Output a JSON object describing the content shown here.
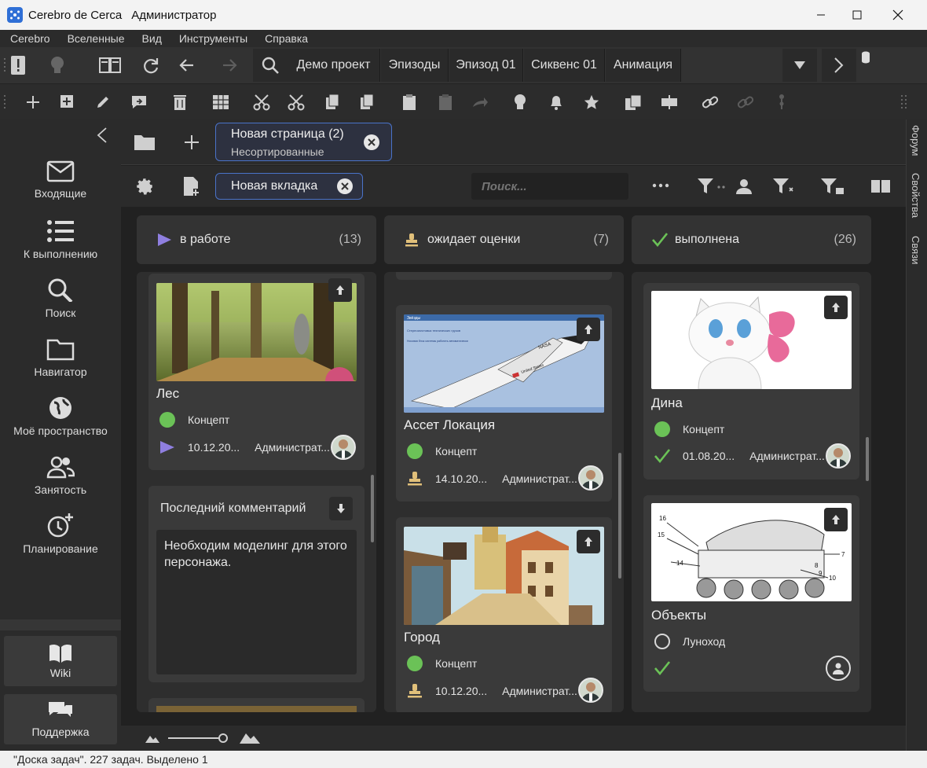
{
  "window": {
    "app_name": "Cerebro de Cerca",
    "user": "Администратор"
  },
  "menu": [
    "Cerebro",
    "Вселенные",
    "Вид",
    "Инструменты",
    "Справка"
  ],
  "breadcrumbs": [
    "Демо проект",
    "Эпизоды",
    "Эпизод 01",
    "Сиквенс 01",
    "Анимация"
  ],
  "sidebar": {
    "items": [
      {
        "label": "Входящие",
        "icon": "mail-icon"
      },
      {
        "label": "К выполнению",
        "icon": "list-icon"
      },
      {
        "label": "Поиск",
        "icon": "search-icon"
      },
      {
        "label": "Навигатор",
        "icon": "folder-icon"
      },
      {
        "label": "Моё пространство",
        "icon": "globe-icon"
      },
      {
        "label": "Занятость",
        "icon": "people-icon"
      },
      {
        "label": "Планирование",
        "icon": "clock-plus-icon"
      }
    ],
    "wiki": "Wiki",
    "support": "Поддержка"
  },
  "page_tab": {
    "title": "Новая страница (2)",
    "subtitle": "Несортированные"
  },
  "view_tab": {
    "title": "Новая вкладка"
  },
  "search": {
    "placeholder": "Поиск..."
  },
  "right_tabs": [
    "Форум",
    "Свойства",
    "Связи"
  ],
  "columns": [
    {
      "title": "в работе",
      "count": "(13)",
      "color": "#8f7fe0"
    },
    {
      "title": "ожидает оценки",
      "count": "(7)",
      "color": "#e1c07a"
    },
    {
      "title": "выполнена",
      "count": "(26)",
      "color": "#6bc257"
    }
  ],
  "cards": {
    "les": {
      "name": "Лес",
      "activity": "Концепт",
      "date": "10.12.20...",
      "user": "Администрат..."
    },
    "comment": {
      "title": "Последний комментарий",
      "text": "Необходим моделинг для этого персонажа."
    },
    "asset": {
      "name": "Ассет Локация",
      "activity": "Концепт",
      "date": "14.10.20...",
      "user": "Администрат..."
    },
    "gorod": {
      "name": "Город",
      "activity": "Концепт",
      "date": "10.12.20...",
      "user": "Администрат..."
    },
    "dina": {
      "name": "Дина",
      "activity": "Концепт",
      "date": "01.08.20...",
      "user": "Администрат..."
    },
    "objects": {
      "name": "Объекты",
      "activity": "Луноход"
    }
  },
  "shuttle_text": {
    "top": "Звёзды",
    "head": "Стереоизготовка технических грузов",
    "note_left": "Носовая блок системы работать автоматически",
    "label": "NASA",
    "flag_text": "United States"
  },
  "rover_labels": [
    "16",
    "15",
    "14",
    "7",
    "8",
    "9",
    "10"
  ],
  "status": "\"Доска задач\". 227 задач. Выделено 1"
}
